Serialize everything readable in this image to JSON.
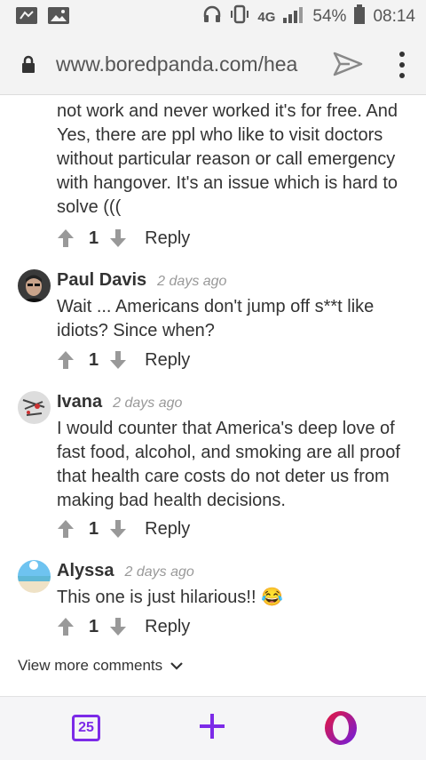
{
  "status_bar": {
    "battery": "54%",
    "time": "08:14",
    "network": "4G"
  },
  "address_bar": {
    "url": "www.boredpanda.com/hea"
  },
  "partial_comment": {
    "text": "not work and never worked it's for free. And Yes, there are ppl who like to visit doctors without particular reason or call emergency with hangover. It's an issue which is hard to solve (((",
    "votes": "1",
    "reply_label": "Reply"
  },
  "comments": [
    {
      "author": "Paul Davis",
      "time": "2 days ago",
      "text": "Wait ... Americans don't jump off s**t like idiots? Since when?",
      "votes": "1",
      "reply_label": "Reply"
    },
    {
      "author": "Ivana",
      "time": "2 days ago",
      "text": "I would counter that America's deep love of fast food, alcohol, and smoking are all proof that health care costs do not deter us from making bad health decisions.",
      "votes": "1",
      "reply_label": "Reply"
    },
    {
      "author": "Alyssa",
      "time": "2 days ago",
      "text": "This one is just hilarious!! 😂",
      "votes": "1",
      "reply_label": "Reply"
    }
  ],
  "view_more": "View more comments",
  "bottom_bar": {
    "tab_count": "25"
  },
  "colors": {
    "accent": "#7c2ae8",
    "opera_red": "#e8173a"
  }
}
